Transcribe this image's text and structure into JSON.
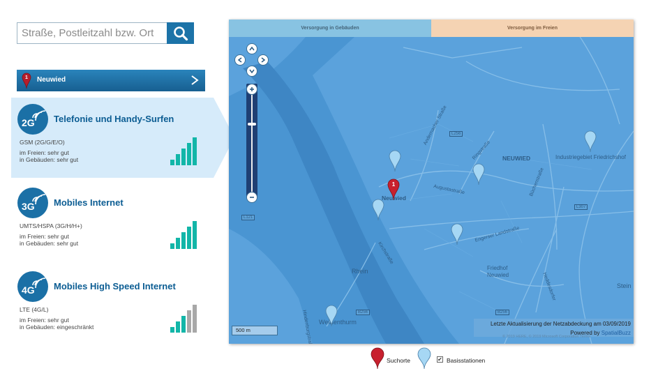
{
  "search": {
    "placeholder": "Straße, Postleitzahl bzw. Ort",
    "value": ""
  },
  "icons": {
    "search_button": "search-icon",
    "location_pin": "map-pin-icon",
    "chevron": "chevron-right-icon"
  },
  "location": {
    "number": "1",
    "name": "Neuwied"
  },
  "panels": [
    {
      "badge": "2G",
      "title": "Telefonie und Handy-Surfen",
      "standard": "GSM (2G/G/E/O)",
      "outdoor": "im Freien: sehr gut",
      "indoor": "in Gebäuden: sehr gut",
      "signal_level": 5,
      "active": true
    },
    {
      "badge": "3G",
      "title": "Mobiles Internet",
      "standard": "UMTS/HSPA (3G/H/H+)",
      "outdoor": "im Freien: sehr gut",
      "indoor": "in Gebäuden: sehr gut",
      "signal_level": 5,
      "active": false
    },
    {
      "badge": "4G",
      "title": "Mobiles High Speed Internet",
      "standard": "LTE (4G/L)",
      "outdoor": "im Freien: sehr gut",
      "indoor": "in Gebäuden: eingeschränkt",
      "signal_level": 3,
      "active": false
    }
  ],
  "colors": {
    "accent": "#1b70a6",
    "signal_on": "#12b6a8",
    "signal_off": "#a8a8a8",
    "map_water": "#4a95d2",
    "tab_indoor": "#88c3e2",
    "tab_outdoor": "#f5d3b3",
    "marker_red": "#c8202e",
    "marker_blue": "#9fd4f3"
  },
  "map": {
    "tab_indoor": "Versorgung in Gebäuden",
    "tab_outdoor": "Versorgung im Freien",
    "scale": "500 m",
    "update_text": "Letzte Aktualisierung der Netzabdeckung am 03/09/2019",
    "powered_prefix": "Powered by",
    "powered_link": "SpatialBuzz",
    "copyright": "© 2019 HERE, © 2019 Microsoft Corporation  Terms",
    "labels": {
      "neuwied_marker": "Neuwied",
      "neuwied_city": "NEUWIED",
      "industrie": "Industriegebiet Friedrichshof",
      "rhein": "Rhein",
      "weissenthurm": "Weißenthurm",
      "friedhof": "Friedhof\nNeuwied",
      "stein": "Stein",
      "andernacher": "Andernacher Straße",
      "ringstrasse": "Ringstraße",
      "augusta": "Augustastraße",
      "engerser": "Engerser Landstraße",
      "kirchstrasse": "Kirchstraße",
      "buchenstrasse": "Büchenstraße",
      "heddesdorfer": "Heddesdorfer",
      "hindenburgstrasse": "Hindenburgstraße"
    },
    "road_tags": {
      "l256": "L256",
      "l307": "L307",
      "l121": "L121",
      "b256": "B256",
      "b256b": "B256"
    }
  },
  "legend": {
    "search_label": "Suchorte",
    "station_label": "Basisstationen",
    "stations_checked": true
  }
}
